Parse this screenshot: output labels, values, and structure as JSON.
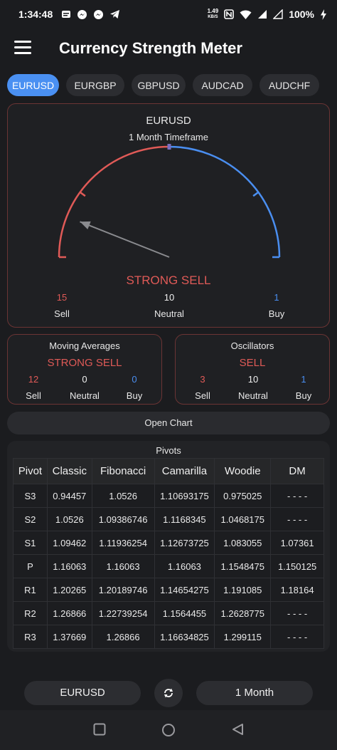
{
  "status_bar": {
    "time": "1:34:48",
    "net_speed_value": "1.49",
    "net_speed_unit": "KB/S",
    "battery": "100%"
  },
  "app_bar": {
    "title": "Currency Strength Meter"
  },
  "pairs": [
    "EURUSD",
    "EURGBP",
    "GBPUSD",
    "AUDCAD",
    "AUDCHF"
  ],
  "selected_pair": "EURUSD",
  "summary": {
    "pair": "EURUSD",
    "timeframe": "1 Month Timeframe",
    "signal": "STRONG SELL",
    "needle_value": 0.12,
    "sell_count": "15",
    "neutral_count": "10",
    "buy_count": "1",
    "sell_label": "Sell",
    "neutral_label": "Neutral",
    "buy_label": "Buy"
  },
  "moving_averages": {
    "title": "Moving Averages",
    "signal": "STRONG SELL",
    "sell": "12",
    "neutral": "0",
    "buy": "0",
    "sell_label": "Sell",
    "neutral_label": "Neutral",
    "buy_label": "Buy"
  },
  "oscillators": {
    "title": "Oscillators",
    "signal": "SELL",
    "sell": "3",
    "neutral": "10",
    "buy": "1",
    "sell_label": "Sell",
    "neutral_label": "Neutral",
    "buy_label": "Buy"
  },
  "open_chart_label": "Open Chart",
  "pivots": {
    "title": "Pivots",
    "headers": [
      "Pivot",
      "Classic",
      "Fibonacci",
      "Camarilla",
      "Woodie",
      "DM"
    ],
    "rows": [
      [
        "S3",
        "0.94457",
        "1.0526",
        "1.10693175",
        "0.975025",
        "- - - -"
      ],
      [
        "S2",
        "1.0526",
        "1.09386746",
        "1.1168345",
        "1.0468175",
        "- - - -"
      ],
      [
        "S1",
        "1.09462",
        "1.11936254",
        "1.12673725",
        "1.083055",
        "1.07361"
      ],
      [
        "P",
        "1.16063",
        "1.16063",
        "1.16063",
        "1.1548475",
        "1.150125"
      ],
      [
        "R1",
        "1.20265",
        "1.20189746",
        "1.14654275",
        "1.191085",
        "1.18164"
      ],
      [
        "R2",
        "1.26866",
        "1.22739254",
        "1.1564455",
        "1.2628775",
        "- - - -"
      ],
      [
        "R3",
        "1.37669",
        "1.26866",
        "1.16634825",
        "1.299115",
        "- - - -"
      ]
    ]
  },
  "bottom": {
    "pair": "EURUSD",
    "timeframe": "1 Month"
  },
  "colors": {
    "sell": "#e05a57",
    "buy": "#4a8ef0",
    "accent": "#4a90f2"
  }
}
